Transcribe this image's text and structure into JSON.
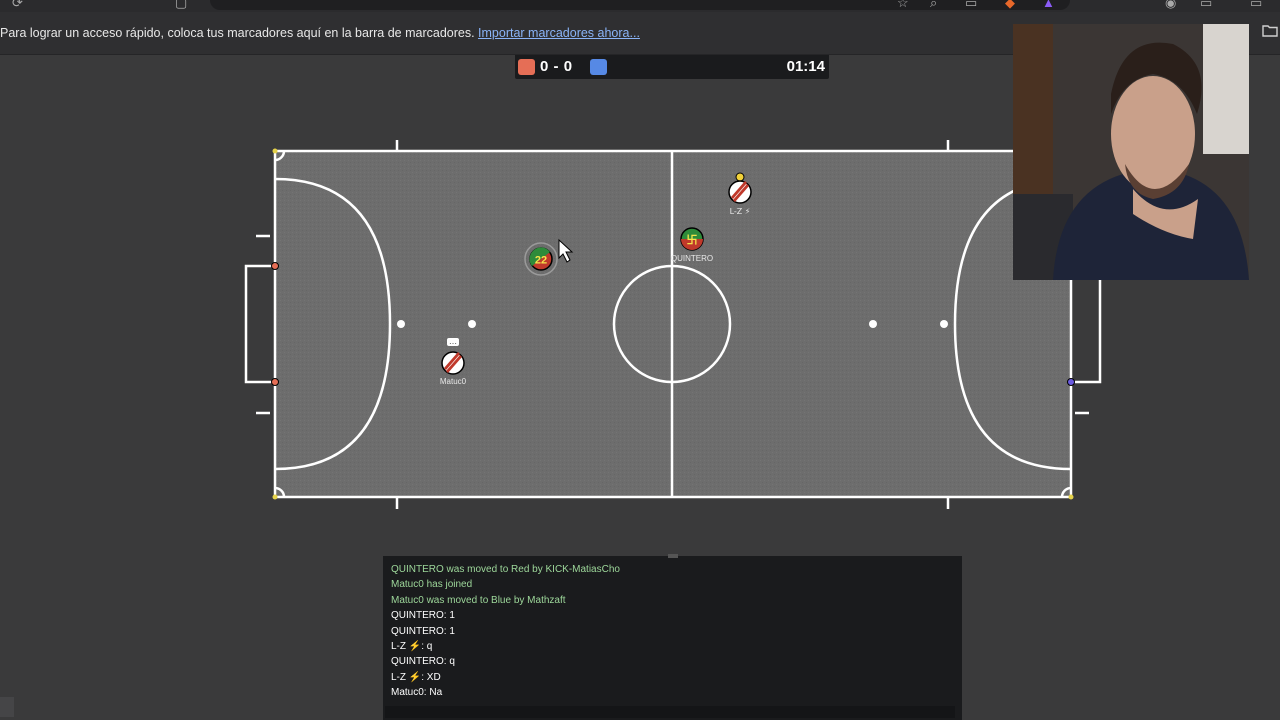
{
  "browser": {
    "bookmarks_bar_message": "Para lograr un acceso rápido, coloca tus marcadores aquí en la barra de marcadores.",
    "bookmarks_bar_link": "Importar marcadores ahora..."
  },
  "scoreboard": {
    "red_score": "0",
    "separator": "-",
    "blue_score": "0",
    "timer": "01:14",
    "red_color": "#e56e56",
    "blue_color": "#5689e5"
  },
  "players": [
    {
      "avatar": "22",
      "name": "",
      "team": "red-green"
    },
    {
      "avatar": "卐",
      "name": "QUINTERO",
      "team": "red-green"
    },
    {
      "avatar": "",
      "name": "L-Z ⚡",
      "team": "red-white"
    },
    {
      "avatar": "",
      "name": "Matuc0",
      "team": "red-white",
      "chat_indicator": "…"
    }
  ],
  "chat": {
    "lines": [
      {
        "text": "QUINTERO was moved to Red by KICK-MatiasCho",
        "kind": "system"
      },
      {
        "text": "Matuc0 has joined",
        "kind": "system"
      },
      {
        "text": "Matuc0 was moved to Blue by Mathzaft",
        "kind": "system"
      },
      {
        "text": "QUINTERO: 1",
        "kind": "message"
      },
      {
        "text": "QUINTERO: 1",
        "kind": "message"
      },
      {
        "text": "L-Z ⚡: q",
        "kind": "message"
      },
      {
        "text": "QUINTERO: q",
        "kind": "message"
      },
      {
        "text": "L-Z ⚡: XD",
        "kind": "message"
      },
      {
        "text": "Matuc0: Na",
        "kind": "message"
      }
    ]
  },
  "colors": {
    "field_line": "#ffffff",
    "pitch": "#6e6e6e",
    "chat_system": "#9dd79a"
  }
}
